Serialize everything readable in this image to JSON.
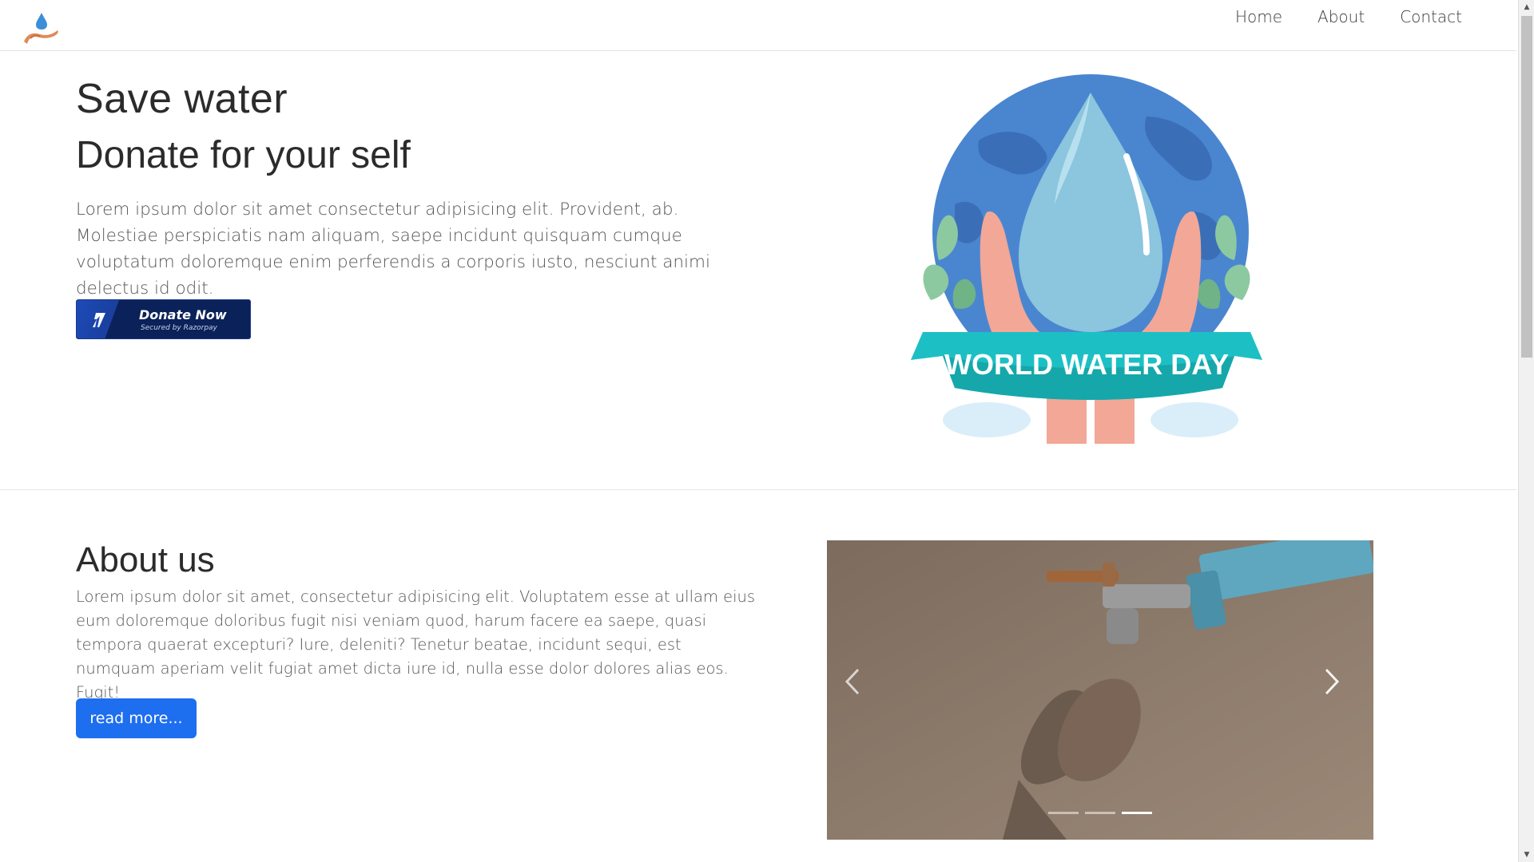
{
  "nav": {
    "logo_icon": "water-drop-hand-icon",
    "links": [
      "Home",
      "About",
      "Contact"
    ]
  },
  "hero": {
    "title": "Save water",
    "subtitle": "Donate for your self",
    "text": "Lorem ipsum dolor sit amet consectetur adipisicing elit. Provident, ab. Molestiae perspiciatis nam aliquam, saepe incidunt quisquam cumque voluptatum doloremque enim perferendis a corporis iusto, nesciunt animi delectus id odit.",
    "donate_label": "Donate Now",
    "donate_sub": "Secured by Razorpay",
    "illustration_banner": "WORLD WATER DAY"
  },
  "about": {
    "title": "About us",
    "text": "Lorem ipsum dolor sit amet, consectetur adipisicing elit. Voluptatem esse at ullam eius eum doloremque doloribus fugit nisi veniam quod, harum facere ea saepe, quasi tempora quaerat excepturi? Iure, deleniti? Tenetur beatae, incidunt sequi, est numquam aperiam velit fugiat amet dicta iure id, nulla esse dolor dolores alias eos. Fugit!",
    "read_more_label": "read more..."
  },
  "carousel": {
    "slide_count": 3,
    "active_index": 2
  },
  "colors": {
    "primary_button": "#1e6ef0",
    "donate_bg": "#0b2159",
    "banner_teal": "#1cc0c4"
  }
}
